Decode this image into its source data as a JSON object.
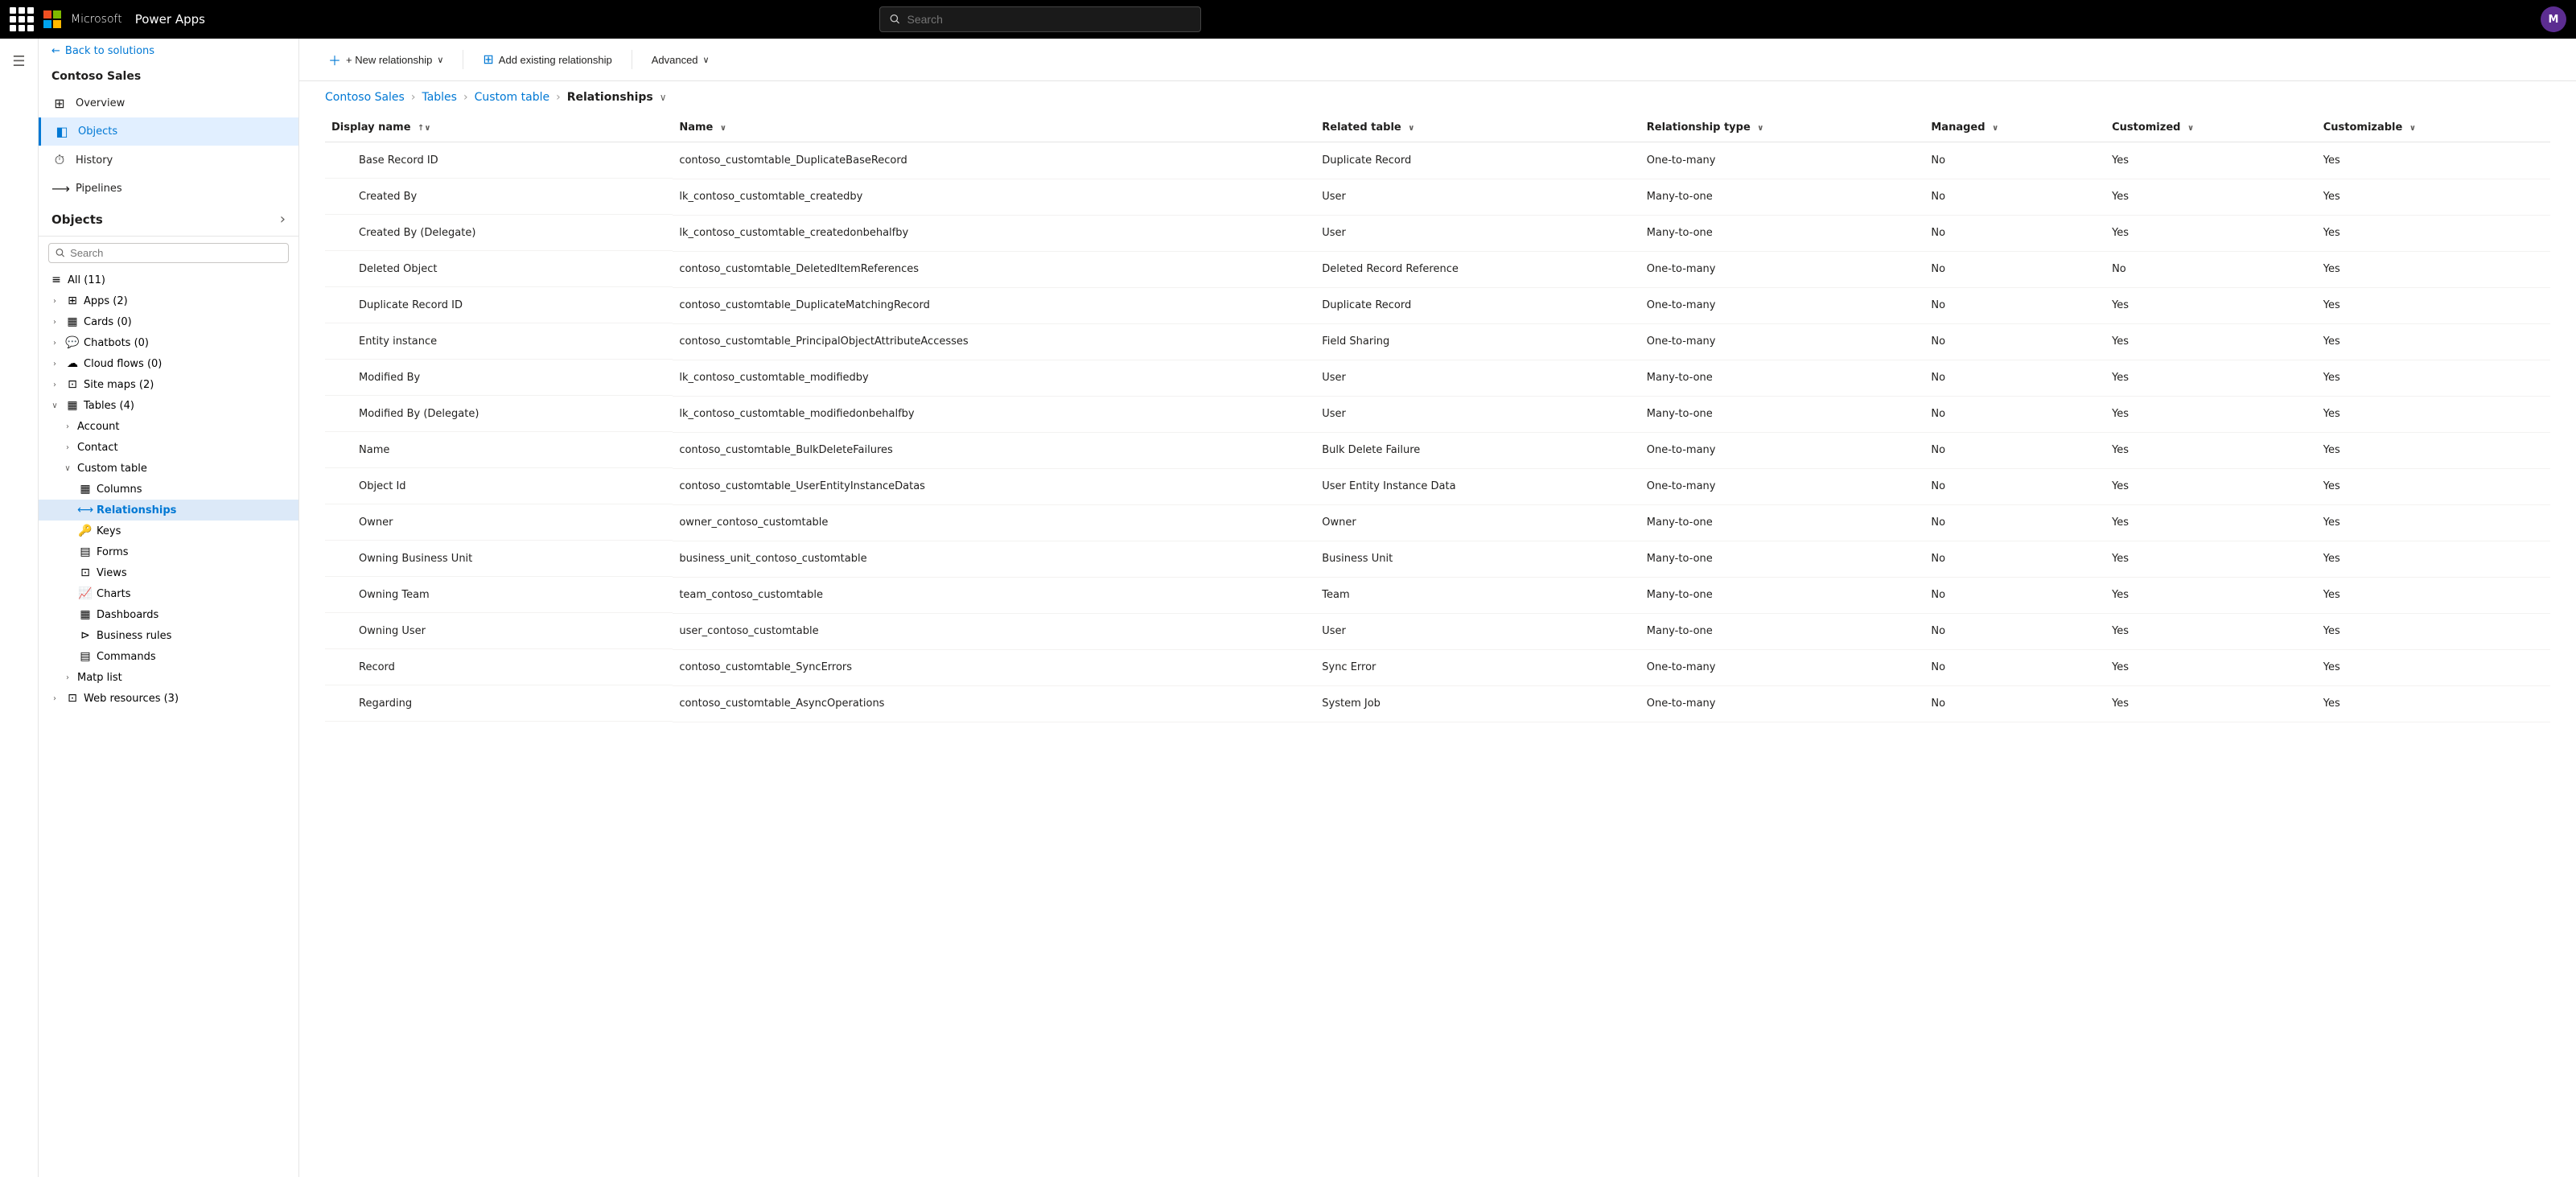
{
  "topbar": {
    "product": "Power Apps",
    "search_placeholder": "Search",
    "avatar_initials": "M"
  },
  "back_link": "Back to solutions",
  "app_title": "Contoso Sales",
  "nav_items": [
    {
      "id": "overview",
      "label": "Overview",
      "icon": "⊞",
      "active": false
    },
    {
      "id": "objects",
      "label": "Objects",
      "icon": "◧",
      "active": true
    },
    {
      "id": "history",
      "label": "History",
      "icon": "⏱",
      "active": false
    },
    {
      "id": "pipelines",
      "label": "Pipelines",
      "icon": "⟶",
      "active": false
    }
  ],
  "objects_panel": {
    "title": "Objects",
    "search_placeholder": "Search"
  },
  "sidebar_tree": [
    {
      "id": "all",
      "label": "All",
      "count": "(11)",
      "indent": 0,
      "icon": "≡",
      "expanded": false
    },
    {
      "id": "apps",
      "label": "Apps",
      "count": "(2)",
      "indent": 0,
      "icon": "⊞",
      "expanded": false
    },
    {
      "id": "cards",
      "label": "Cards",
      "count": "(0)",
      "indent": 0,
      "icon": "▦",
      "expanded": false
    },
    {
      "id": "chatbots",
      "label": "Chatbots",
      "count": "(0)",
      "indent": 0,
      "icon": "💬",
      "expanded": false
    },
    {
      "id": "cloud-flows",
      "label": "Cloud flows",
      "count": "(0)",
      "indent": 0,
      "icon": "☁",
      "expanded": false
    },
    {
      "id": "site-maps",
      "label": "Site maps",
      "count": "(2)",
      "indent": 0,
      "icon": "⊡",
      "expanded": false
    },
    {
      "id": "tables",
      "label": "Tables",
      "count": "(4)",
      "indent": 0,
      "icon": "▦",
      "expanded": true
    },
    {
      "id": "account",
      "label": "Account",
      "indent": 1,
      "icon": "",
      "expanded": false
    },
    {
      "id": "contact",
      "label": "Contact",
      "indent": 1,
      "icon": "",
      "expanded": false
    },
    {
      "id": "custom-table",
      "label": "Custom table",
      "indent": 1,
      "icon": "",
      "expanded": true
    },
    {
      "id": "columns",
      "label": "Columns",
      "indent": 2,
      "icon": "▦",
      "expanded": false
    },
    {
      "id": "relationships",
      "label": "Relationships",
      "indent": 2,
      "icon": "⟷",
      "expanded": false,
      "active": true
    },
    {
      "id": "keys",
      "label": "Keys",
      "indent": 2,
      "icon": "🔑",
      "expanded": false
    },
    {
      "id": "forms",
      "label": "Forms",
      "indent": 2,
      "icon": "▤",
      "expanded": false
    },
    {
      "id": "views",
      "label": "Views",
      "indent": 2,
      "icon": "⊡",
      "expanded": false
    },
    {
      "id": "charts",
      "label": "Charts",
      "indent": 2,
      "icon": "📈",
      "expanded": false
    },
    {
      "id": "dashboards",
      "label": "Dashboards",
      "indent": 2,
      "icon": "▦",
      "expanded": false
    },
    {
      "id": "business-rules",
      "label": "Business rules",
      "indent": 2,
      "icon": "⊳",
      "expanded": false
    },
    {
      "id": "commands",
      "label": "Commands",
      "indent": 2,
      "icon": "▤",
      "expanded": false
    },
    {
      "id": "matp-list",
      "label": "Matp list",
      "indent": 1,
      "icon": "",
      "expanded": false
    },
    {
      "id": "web-resources",
      "label": "Web resources",
      "count": "(3)",
      "indent": 0,
      "icon": "⊡",
      "expanded": false
    }
  ],
  "toolbar": {
    "new_relationship": "+ New relationship",
    "add_existing": "Add existing relationship",
    "advanced": "Advanced"
  },
  "breadcrumb": {
    "items": [
      "Contoso Sales",
      "Tables",
      "Custom table",
      "Relationships"
    ]
  },
  "table": {
    "columns": [
      {
        "id": "display-name",
        "label": "Display name",
        "sort": "asc"
      },
      {
        "id": "name",
        "label": "Name",
        "sort": "none"
      },
      {
        "id": "related-table",
        "label": "Related table",
        "sort": "none"
      },
      {
        "id": "relationship-type",
        "label": "Relationship type",
        "sort": "none"
      },
      {
        "id": "managed",
        "label": "Managed",
        "sort": "none"
      },
      {
        "id": "customized",
        "label": "Customized",
        "sort": "none"
      },
      {
        "id": "customizable",
        "label": "Customizable",
        "sort": "none"
      }
    ],
    "rows": [
      {
        "display_name": "Base Record ID",
        "name": "contoso_customtable_DuplicateBaseRecord",
        "related_table": "Duplicate Record",
        "relationship_type": "One-to-many",
        "managed": "No",
        "customized": "Yes",
        "customizable": "Yes"
      },
      {
        "display_name": "Created By",
        "name": "lk_contoso_customtable_createdby",
        "related_table": "User",
        "relationship_type": "Many-to-one",
        "managed": "No",
        "customized": "Yes",
        "customizable": "Yes"
      },
      {
        "display_name": "Created By (Delegate)",
        "name": "lk_contoso_customtable_createdonbehalfby",
        "related_table": "User",
        "relationship_type": "Many-to-one",
        "managed": "No",
        "customized": "Yes",
        "customizable": "Yes"
      },
      {
        "display_name": "Deleted Object",
        "name": "contoso_customtable_DeletedItemReferences",
        "related_table": "Deleted Record Reference",
        "relationship_type": "One-to-many",
        "managed": "No",
        "customized": "No",
        "customizable": "Yes"
      },
      {
        "display_name": "Duplicate Record ID",
        "name": "contoso_customtable_DuplicateMatchingRecord",
        "related_table": "Duplicate Record",
        "relationship_type": "One-to-many",
        "managed": "No",
        "customized": "Yes",
        "customizable": "Yes"
      },
      {
        "display_name": "Entity instance",
        "name": "contoso_customtable_PrincipalObjectAttributeAccesses",
        "related_table": "Field Sharing",
        "relationship_type": "One-to-many",
        "managed": "No",
        "customized": "Yes",
        "customizable": "Yes"
      },
      {
        "display_name": "Modified By",
        "name": "lk_contoso_customtable_modifiedby",
        "related_table": "User",
        "relationship_type": "Many-to-one",
        "managed": "No",
        "customized": "Yes",
        "customizable": "Yes"
      },
      {
        "display_name": "Modified By (Delegate)",
        "name": "lk_contoso_customtable_modifiedonbehalfby",
        "related_table": "User",
        "relationship_type": "Many-to-one",
        "managed": "No",
        "customized": "Yes",
        "customizable": "Yes"
      },
      {
        "display_name": "Name",
        "name": "contoso_customtable_BulkDeleteFailures",
        "related_table": "Bulk Delete Failure",
        "relationship_type": "One-to-many",
        "managed": "No",
        "customized": "Yes",
        "customizable": "Yes"
      },
      {
        "display_name": "Object Id",
        "name": "contoso_customtable_UserEntityInstanceDatas",
        "related_table": "User Entity Instance Data",
        "relationship_type": "One-to-many",
        "managed": "No",
        "customized": "Yes",
        "customizable": "Yes"
      },
      {
        "display_name": "Owner",
        "name": "owner_contoso_customtable",
        "related_table": "Owner",
        "relationship_type": "Many-to-one",
        "managed": "No",
        "customized": "Yes",
        "customizable": "Yes"
      },
      {
        "display_name": "Owning Business Unit",
        "name": "business_unit_contoso_customtable",
        "related_table": "Business Unit",
        "relationship_type": "Many-to-one",
        "managed": "No",
        "customized": "Yes",
        "customizable": "Yes"
      },
      {
        "display_name": "Owning Team",
        "name": "team_contoso_customtable",
        "related_table": "Team",
        "relationship_type": "Many-to-one",
        "managed": "No",
        "customized": "Yes",
        "customizable": "Yes"
      },
      {
        "display_name": "Owning User",
        "name": "user_contoso_customtable",
        "related_table": "User",
        "relationship_type": "Many-to-one",
        "managed": "No",
        "customized": "Yes",
        "customizable": "Yes"
      },
      {
        "display_name": "Record",
        "name": "contoso_customtable_SyncErrors",
        "related_table": "Sync Error",
        "relationship_type": "One-to-many",
        "managed": "No",
        "customized": "Yes",
        "customizable": "Yes"
      },
      {
        "display_name": "Regarding",
        "name": "contoso_customtable_AsyncOperations",
        "related_table": "System Job",
        "relationship_type": "One-to-many",
        "managed": "No",
        "customized": "Yes",
        "customizable": "Yes"
      }
    ]
  }
}
